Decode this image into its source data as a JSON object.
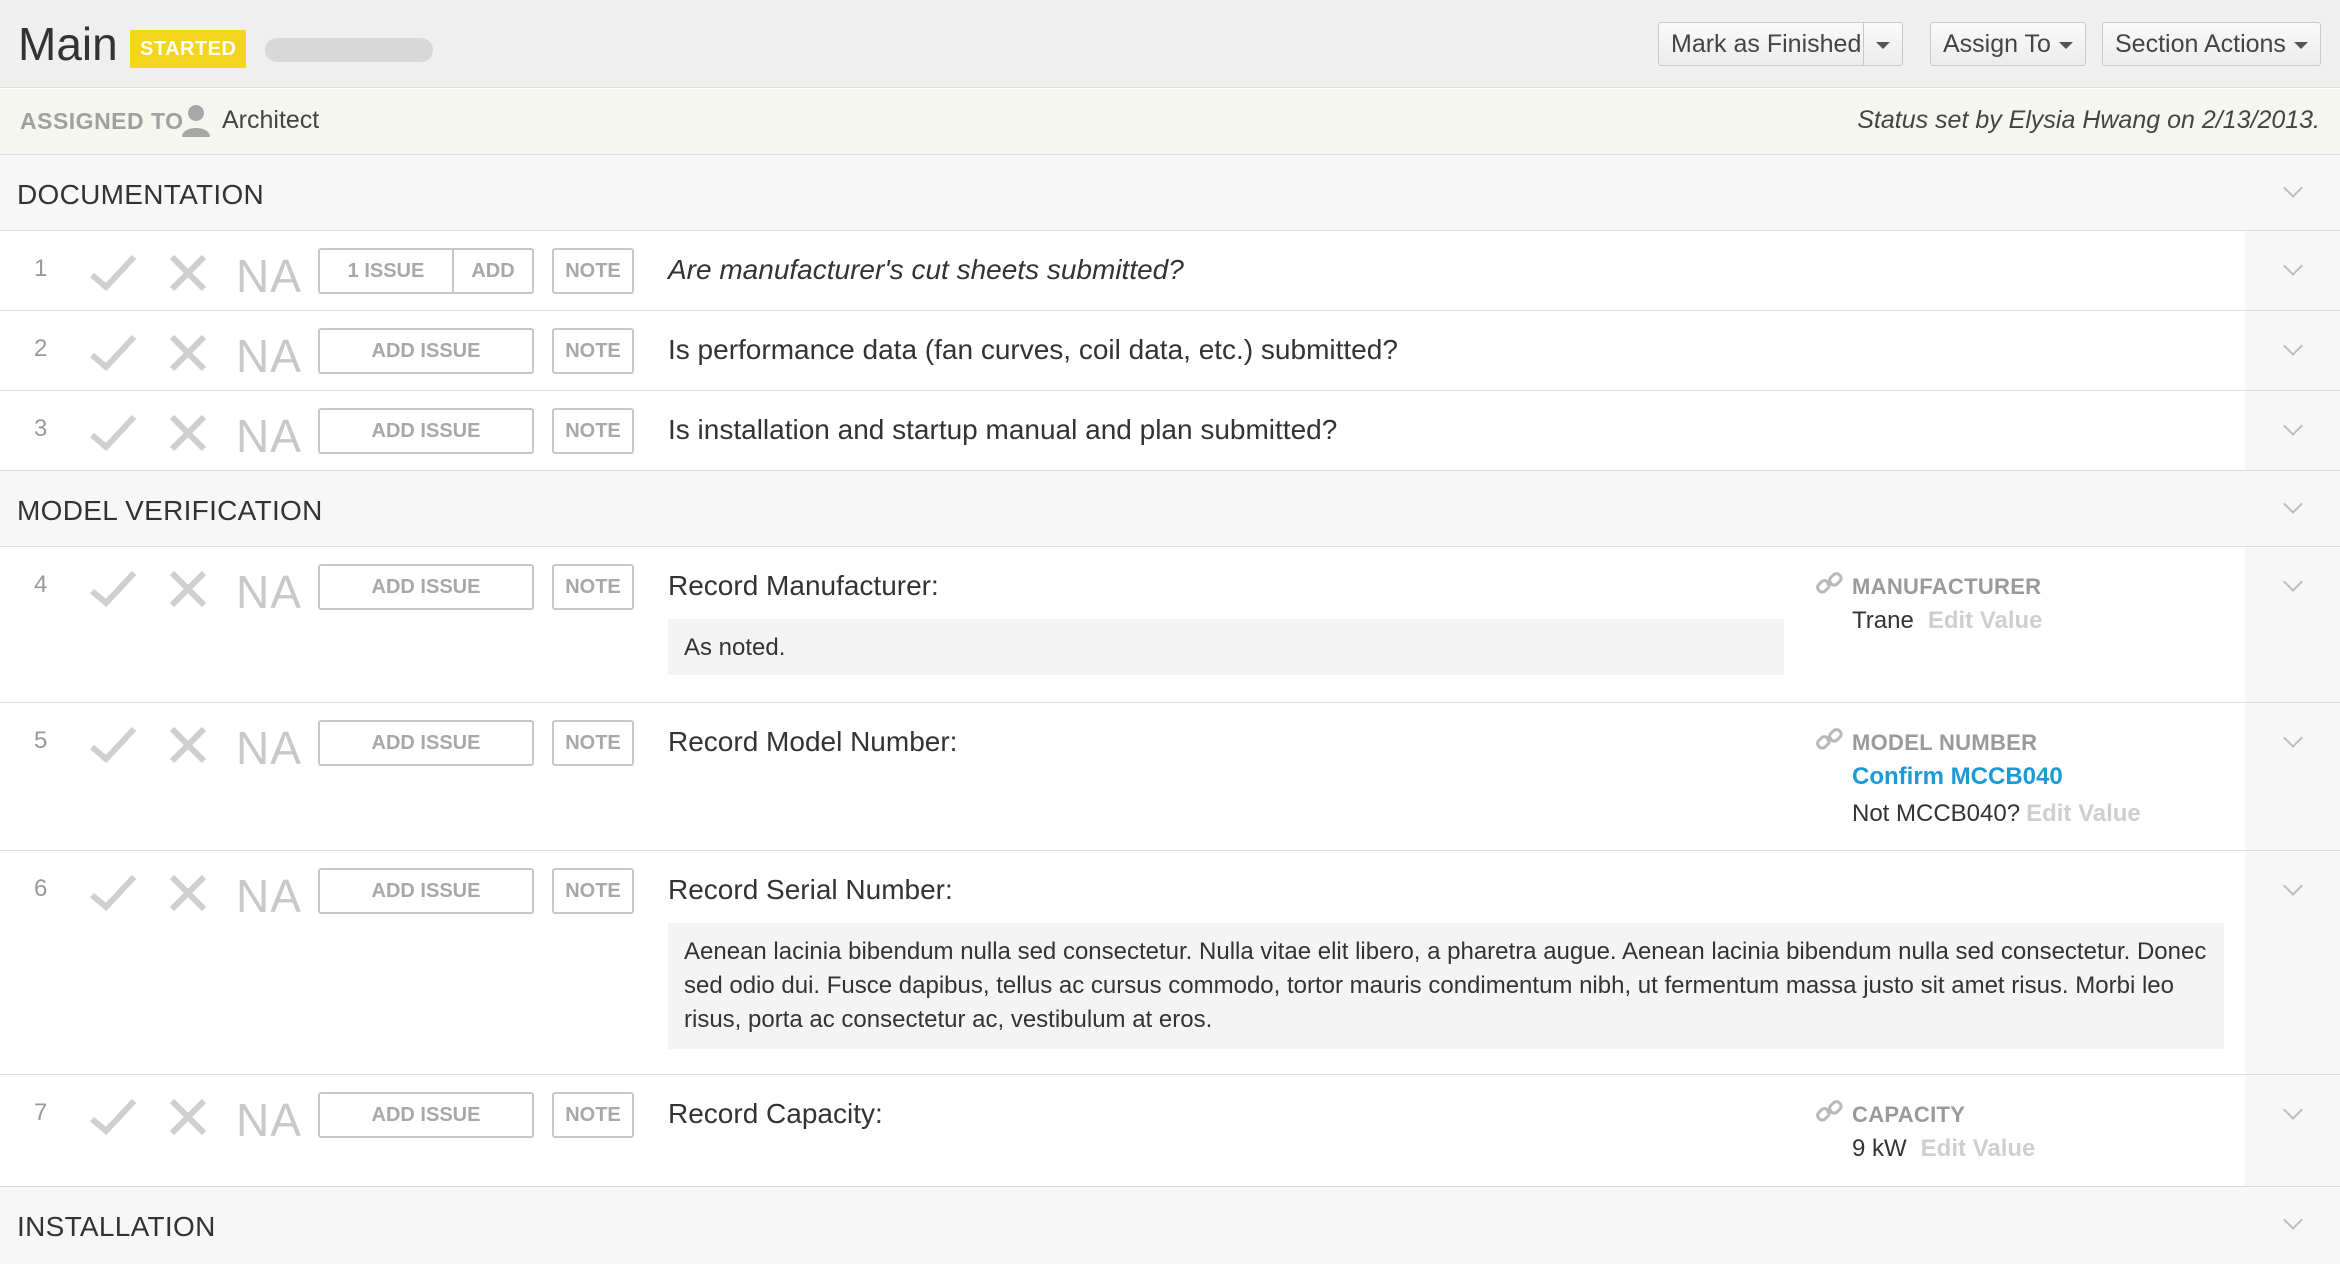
{
  "header": {
    "title": "Main",
    "status_badge": "STARTED",
    "progress_fraction": 0,
    "buttons": {
      "mark_finished": "Mark as Finished",
      "assign_to": "Assign To",
      "section_actions": "Section Actions"
    }
  },
  "assigned": {
    "label": "ASSIGNED TO",
    "name": "Architect",
    "status_text": "Status set by Elysia Hwang on 2/13/2013."
  },
  "sections": [
    {
      "title": "DOCUMENTATION"
    },
    {
      "title": "MODEL VERIFICATION"
    },
    {
      "title": "INSTALLATION"
    }
  ],
  "labels": {
    "na": "NA",
    "add_issue": "ADD ISSUE",
    "note": "NOTE",
    "issue_count": "1 ISSUE",
    "add": "ADD",
    "edit_value": "Edit Value"
  },
  "rows": [
    {
      "num": "1",
      "question": "Are manufacturer's cut sheets submitted?"
    },
    {
      "num": "2",
      "question": "Is performance data (fan curves, coil data, etc.) submitted?"
    },
    {
      "num": "3",
      "question": "Is installation and startup manual and plan submitted?"
    },
    {
      "num": "4",
      "question": "Record Manufacturer:",
      "note": "As noted.",
      "field_label": "MANUFACTURER",
      "field_value": "Trane"
    },
    {
      "num": "5",
      "question": "Record Model Number:",
      "field_label": "MODEL NUMBER",
      "confirm": "Confirm MCCB040",
      "field_value": "Not MCCB040?"
    },
    {
      "num": "6",
      "question": "Record Serial Number:",
      "note": "Aenean lacinia bibendum nulla sed consectetur. Nulla vitae elit libero, a pharetra augue. Aenean lacinia bibendum nulla sed consectetur. Donec sed odio dui. Fusce dapibus, tellus ac cursus commodo, tortor mauris condimentum nibh, ut fermentum massa justo sit amet risus. Morbi leo risus, porta ac consectetur ac, vestibulum at eros."
    },
    {
      "num": "7",
      "question": "Record Capacity:",
      "field_label": "CAPACITY",
      "field_value": "9 kW"
    }
  ]
}
